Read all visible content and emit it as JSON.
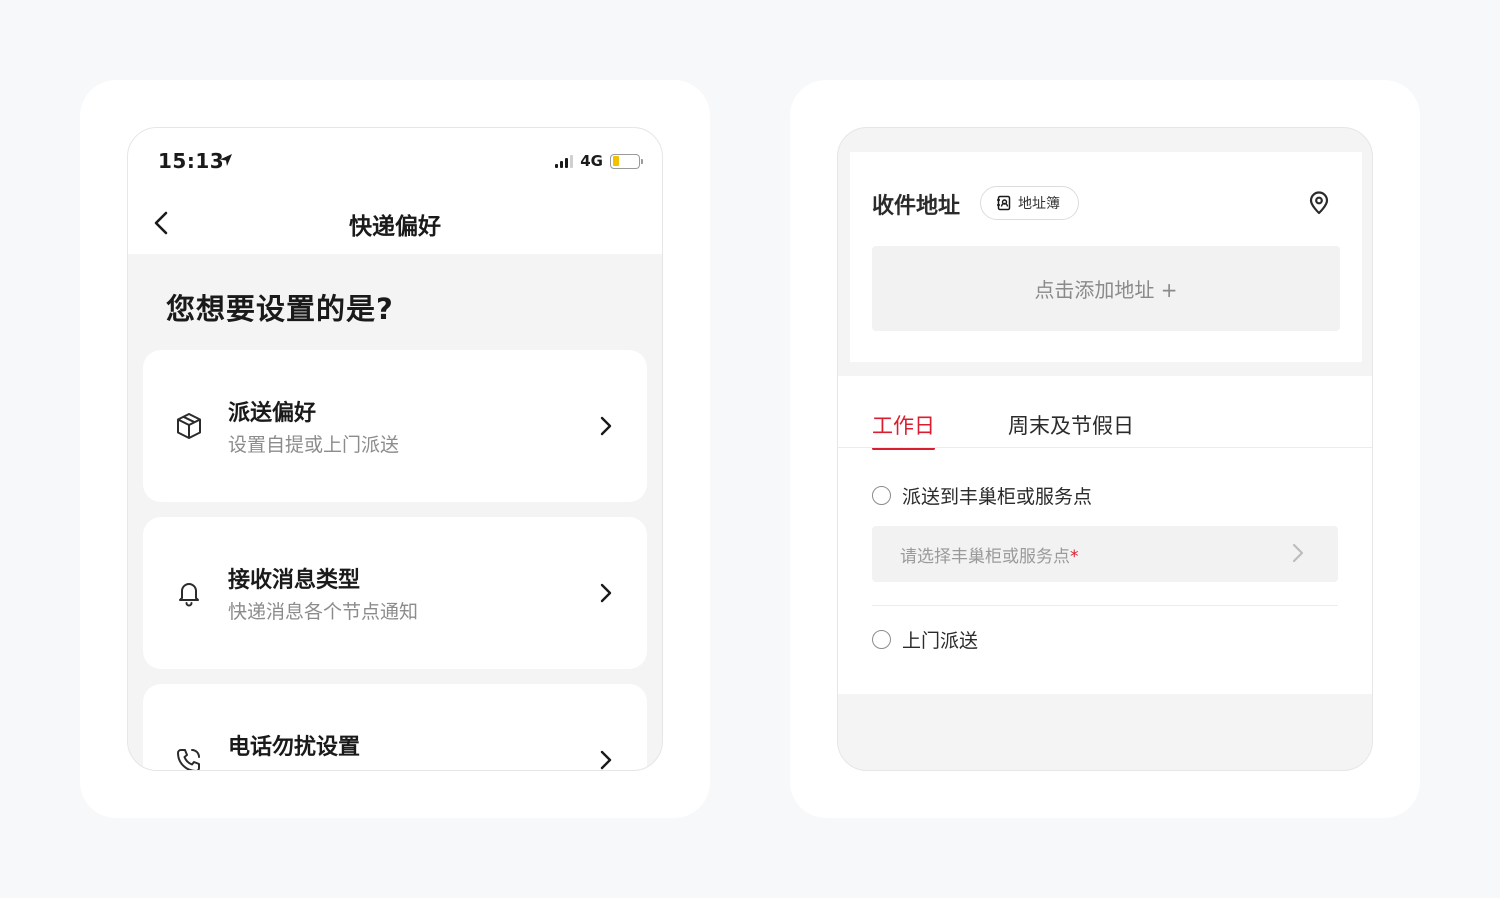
{
  "left_screen": {
    "status_bar": {
      "time": "15:13",
      "network": "4G"
    },
    "nav": {
      "title": "快递偏好"
    },
    "question": "您想要设置的是?",
    "items": [
      {
        "title": "派送偏好",
        "subtitle": "设置自提或上门派送",
        "icon": "package-icon"
      },
      {
        "title": "接收消息类型",
        "subtitle": "快递消息各个节点通知",
        "icon": "bell-icon"
      },
      {
        "title": "电话勿扰设置",
        "subtitle": "",
        "icon": "phone-icon"
      }
    ]
  },
  "right_screen": {
    "address_label": "收件地址",
    "address_book": "地址簿",
    "add_address": "点击添加地址 +",
    "tabs": [
      "工作日",
      "周末及节假日"
    ],
    "options": {
      "locker": "派送到丰巢柜或服务点",
      "locker_placeholder": "请选择丰巢柜或服务点",
      "required_mark": "*",
      "door": "上门派送"
    }
  },
  "colors": {
    "accent": "#d81e30",
    "background": "#f7f8fa",
    "panel_gray": "#f4f4f4"
  }
}
